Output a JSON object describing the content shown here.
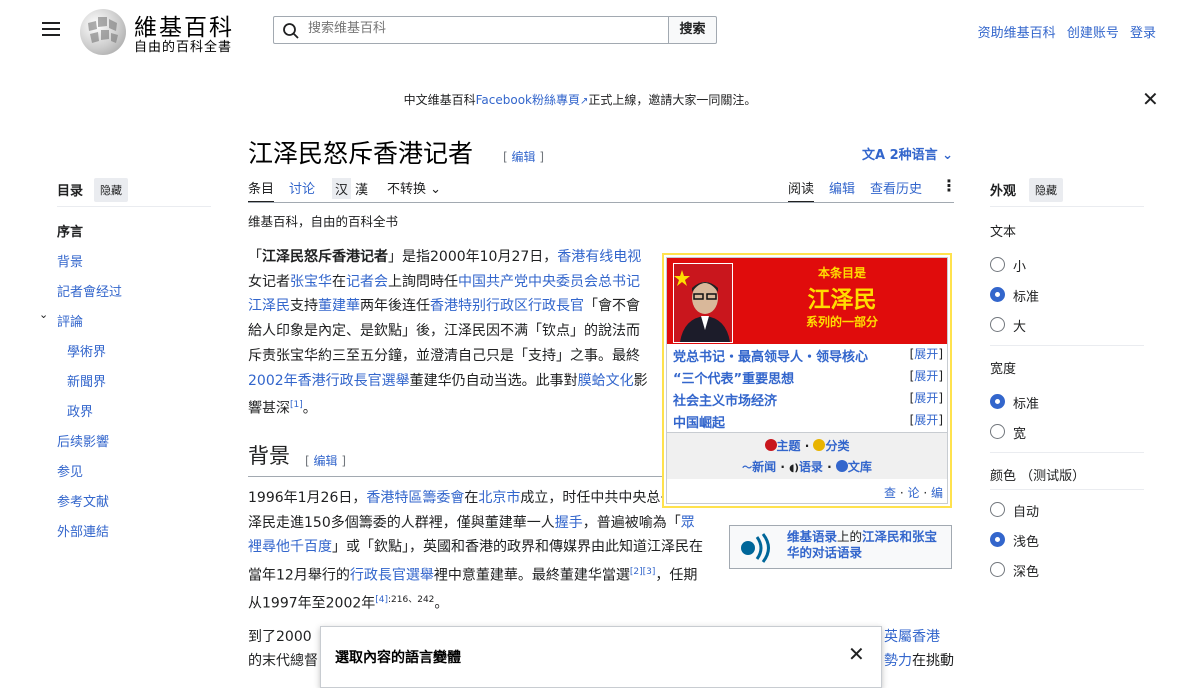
{
  "header": {
    "logo_title": "維基百科",
    "logo_subtitle": "自由的百科全書",
    "search_placeholder": "搜索维基百科",
    "search_button": "搜索",
    "links": [
      "资助维基百科",
      "创建账号",
      "登录"
    ]
  },
  "banner": {
    "prefix": "中文维基百科",
    "link": "Facebook粉絲專頁",
    "suffix": "正式上線，邀請大家一同關注。"
  },
  "page": {
    "title": "江泽民怒斥香港记者",
    "edit_label": "编辑",
    "language_button": "2种语言",
    "tagline": "维基百科，自由的百科全书"
  },
  "tabs": {
    "article": "条目",
    "talk": "讨论",
    "hans": "汉",
    "hant": "漢",
    "variant": "不转换",
    "read": "阅读",
    "edit": "编辑",
    "history": "查看历史"
  },
  "toc": {
    "title": "目录",
    "hide": "隐藏",
    "items": [
      "序言",
      "背景",
      "記者會经过",
      "評論",
      "學術界",
      "新聞界",
      "政界",
      "后续影響",
      "参见",
      "参考文献",
      "外部連結"
    ]
  },
  "intro": {
    "t1": "「",
    "bold": "江泽民怒斥香港记者",
    "t2": "」是指2000年10月27日，",
    "l1": "香港有线电视",
    "t3": "女记者",
    "l2": "张宝华",
    "t4": "在",
    "l3": "记者会",
    "t5": "上詢問時任",
    "l4": "中国共产党中央委员会总书记",
    "l5": "江泽民",
    "t6": "支持",
    "l6": "董建華",
    "t7": "两年後连任",
    "l7": "香港特别行政区行政長官",
    "t8": "「會不會給人印象是內定、是欽點」後，江泽民因不满「钦点」的說法而斥责张宝华約三至五分鐘，並澄清自己只是「支持」之事。最終",
    "l8": "2002年香港行政長官選舉",
    "t9": "董建华仍自动当选。此事對",
    "l9": "膜蛤文化",
    "t10": "影響甚深",
    "ref": "[1]",
    "t11": "。"
  },
  "section": {
    "title": "背景",
    "edit_label": "编辑"
  },
  "background": {
    "t1": "1996年1月26日，",
    "l1": "香港特區籌委會",
    "t2": "在",
    "l2": "北京市",
    "t3": "成立，时任中共中央总书记江泽民走進150多個籌委的人群裡，僅與董建華一人",
    "l3": "握手",
    "t4": "，普遍被喻為「",
    "l4": "眾裡尋他千百度",
    "t5": "」或「欽點」，英國和香港的政界和傳媒界由此知道江泽民在當年12月舉行的",
    "l5": "行政長官選舉",
    "t6": "裡中意董建華。最終董建华當選",
    "ref1": "[2][3]",
    "t7": "，任期从1997年至2002年",
    "ref2": "[4]",
    "t8": ":216、242",
    "t9": "。"
  },
  "third_para": {
    "line1_start": "到了2000",
    "line1_link": "英屬香港",
    "line2_start": "的末代總督",
    "line2_link": "勢力",
    "line2_end": "在挑動"
  },
  "infobox": {
    "head1": "本条目是",
    "head2": "江泽民",
    "head3": "系列的一部分",
    "rows": [
      {
        "label": "党总书记・最高领导人・领导核心",
        "expand": "展开"
      },
      {
        "label": "“三个代表”重要思想",
        "expand": "展开"
      },
      {
        "label": "社会主义市场经济",
        "expand": "展开"
      },
      {
        "label": "中国崛起",
        "expand": "展开"
      }
    ],
    "portal_topic": "主题",
    "portal_category": "分类",
    "portal_news": "新闻",
    "portal_quote": "语录",
    "portal_library": "文库",
    "vte_view": "查",
    "vte_talk": "论",
    "vte_edit": "编"
  },
  "wikiquote": {
    "link1": "维基语录",
    "text1": "上的",
    "link2": "江泽民和张宝华的对话语录"
  },
  "appearance": {
    "title": "外观",
    "hide": "隐藏",
    "text_heading": "文本",
    "text_options": [
      "小",
      "标准",
      "大"
    ],
    "width_heading": "宽度",
    "width_options": [
      "标准",
      "宽"
    ],
    "color_heading": "颜色 （测试版）",
    "color_options": [
      "自动",
      "浅色",
      "深色"
    ],
    "accent": "#3366cc"
  },
  "popup": {
    "title": "選取內容的語言變體"
  }
}
